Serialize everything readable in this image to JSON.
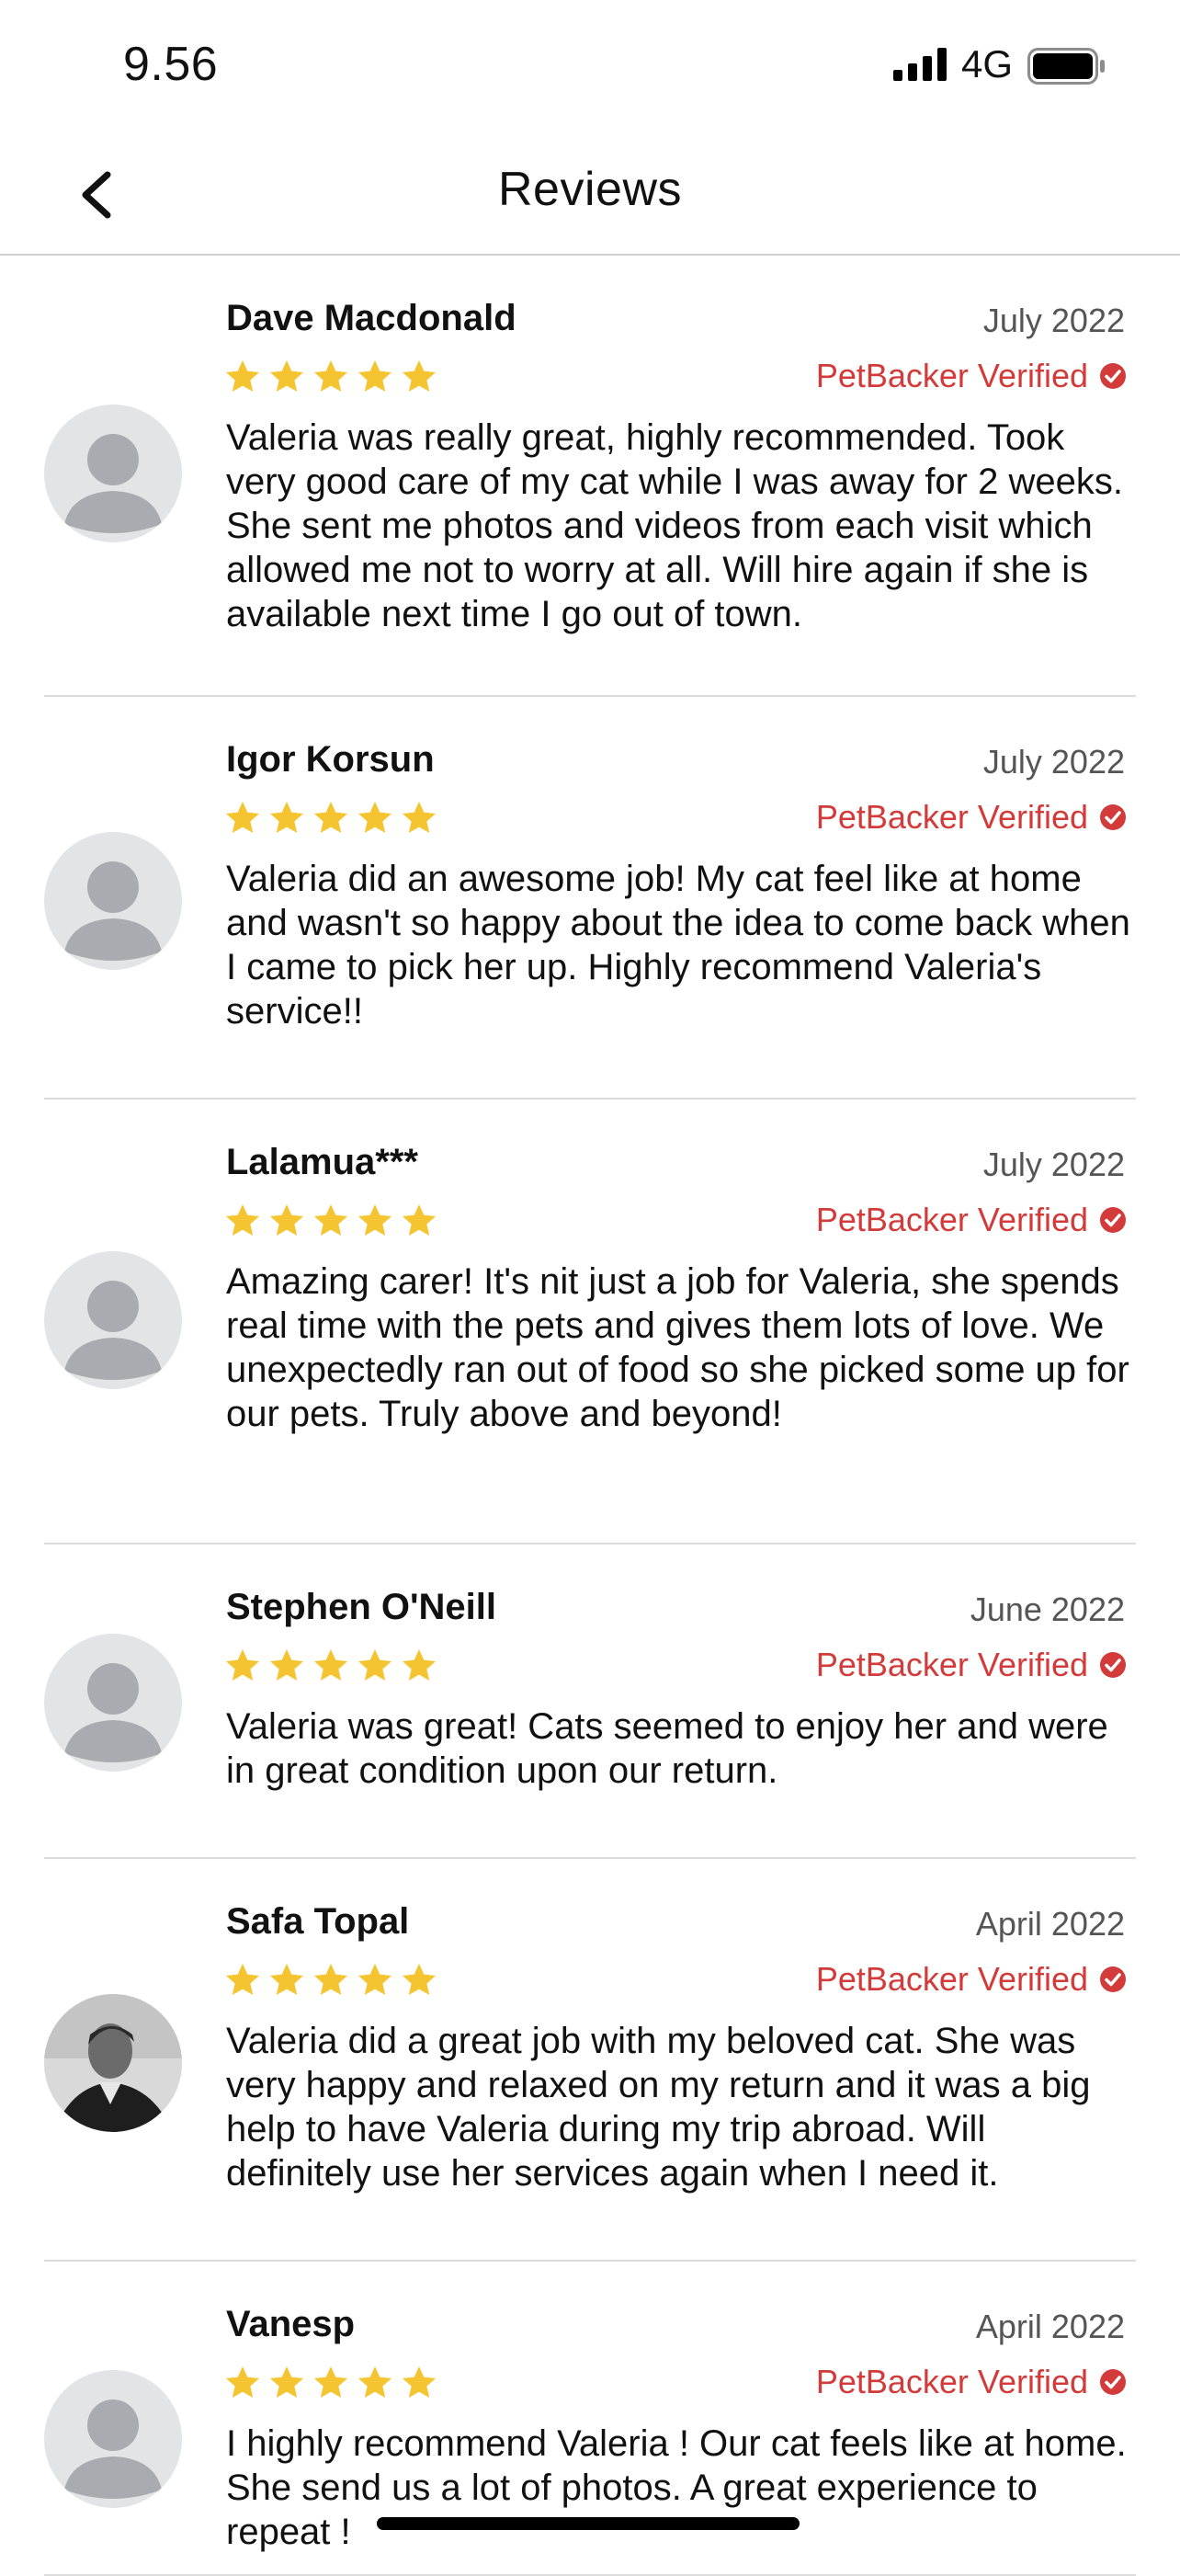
{
  "status_bar": {
    "time": "9.56",
    "network": "4G"
  },
  "header": {
    "title": "Reviews"
  },
  "colors": {
    "star": "#f5c531",
    "verified": "#d33a3a",
    "divider": "#dcdcdc"
  },
  "reviews": [
    {
      "name": "Dave Macdonald",
      "date": "July 2022",
      "rating": 5,
      "verified_label": "PetBacker Verified",
      "text": "Valeria was really great, highly recommended. Took very good care of my cat while I was away for 2 weeks. She sent me photos and videos from each visit which allowed me not to worry at all. Will hire again if she is available next time I go out of town.",
      "avatar": "placeholder-avatar"
    },
    {
      "name": "Igor Korsun",
      "date": "July 2022",
      "rating": 5,
      "verified_label": "PetBacker Verified",
      "text": "Valeria did an awesome job! My cat feel like at home and wasn't so happy about the idea to come back when I came to pick her up. Highly recommend Valeria's service!!",
      "avatar": "placeholder-avatar"
    },
    {
      "name": "Lalamua***",
      "date": "July 2022",
      "rating": 5,
      "verified_label": "PetBacker Verified",
      "text": "Amazing carer! It's nit just a job for Valeria, she spends real time with the pets and gives them lots of love. We unexpectedly ran out of food so she picked some up for our pets. Truly above and beyond!",
      "avatar": "placeholder-avatar"
    },
    {
      "name": "Stephen O'Neill",
      "date": "June 2022",
      "rating": 5,
      "verified_label": "PetBacker Verified",
      "text": "Valeria was great! Cats seemed to enjoy her and were in great condition upon our return.",
      "avatar": "placeholder-avatar"
    },
    {
      "name": "Safa Topal",
      "date": "April 2022",
      "rating": 5,
      "verified_label": "PetBacker Verified",
      "text": "Valeria did a great job with my beloved cat. She was very happy and relaxed on my return and it was a big help to have Valeria during my trip abroad. Will definitely use her services again when I need it.",
      "avatar": "photo-avatar"
    },
    {
      "name": "Vanesp",
      "date": "April 2022",
      "rating": 5,
      "verified_label": "PetBacker Verified",
      "text": "I highly recommend Valeria ! Our cat feels like at home. She send us a lot of photos. A great experience to repeat !",
      "avatar": "placeholder-avatar"
    }
  ]
}
